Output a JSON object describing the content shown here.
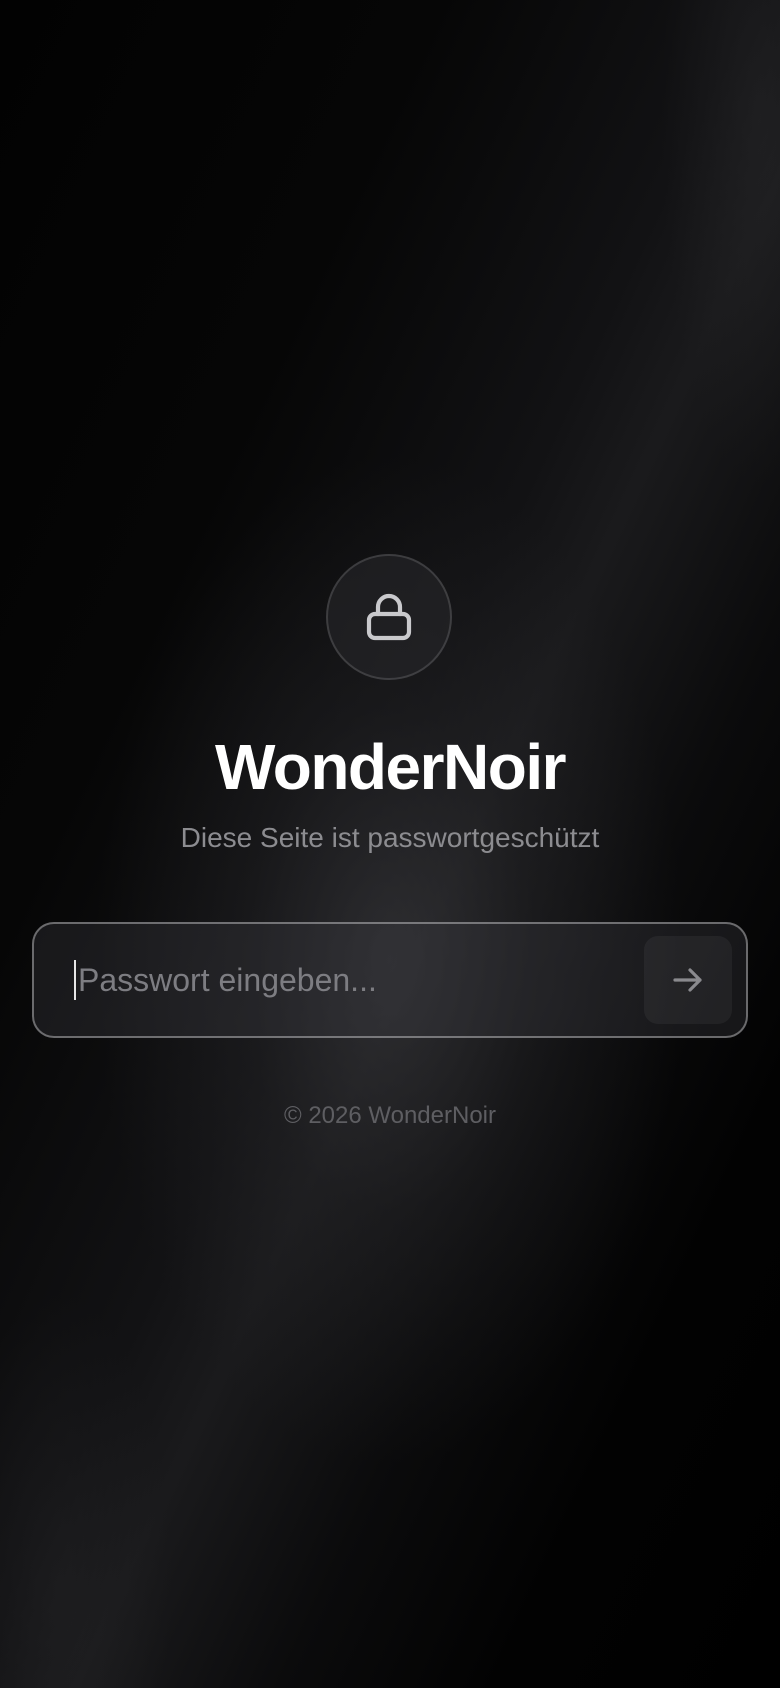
{
  "brand": {
    "title": "WonderNoir",
    "subtitle": "Diese Seite ist passwortgeschützt"
  },
  "lock": {
    "icon": "lock-icon"
  },
  "password": {
    "value": "",
    "placeholder": "Passwort eingeben...",
    "submit_icon": "arrow-right-icon"
  },
  "footer": {
    "copyright": "© 2026 WonderNoir"
  },
  "colors": {
    "background": "#000000",
    "title": "#ffffff",
    "subtitle": "#8c8c90",
    "placeholder": "#7d7d82",
    "footer": "#5e5e62"
  }
}
